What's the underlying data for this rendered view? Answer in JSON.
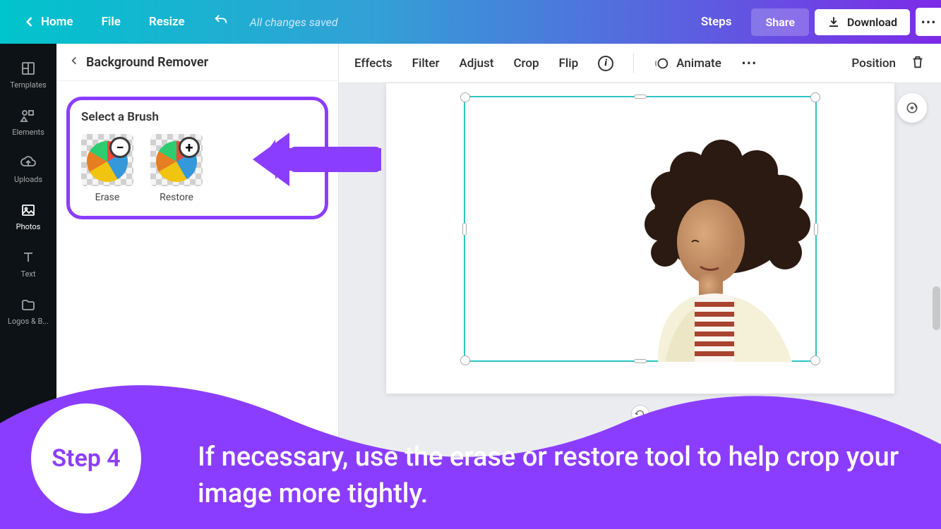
{
  "topbar": {
    "home": "Home",
    "file": "File",
    "resize": "Resize",
    "save_status": "All changes saved",
    "steps": "Steps",
    "share": "Share",
    "download": "Download"
  },
  "sidebar": {
    "items": [
      {
        "label": "Templates"
      },
      {
        "label": "Elements"
      },
      {
        "label": "Uploads"
      },
      {
        "label": "Photos"
      },
      {
        "label": "Text"
      },
      {
        "label": "Logos & B..."
      }
    ]
  },
  "panel": {
    "title": "Background Remover",
    "brush_title": "Select a Brush",
    "erase_label": "Erase",
    "restore_label": "Restore"
  },
  "context_bar": {
    "effects": "Effects",
    "filter": "Filter",
    "adjust": "Adjust",
    "crop": "Crop",
    "flip": "Flip",
    "animate": "Animate",
    "position": "Position"
  },
  "tutorial": {
    "step_label": "Step 4",
    "text": "If necessary, use the erase or restore tool to help crop your image more tightly."
  },
  "colors": {
    "accent": "#8b3dff",
    "selection": "#2cc4c4"
  }
}
